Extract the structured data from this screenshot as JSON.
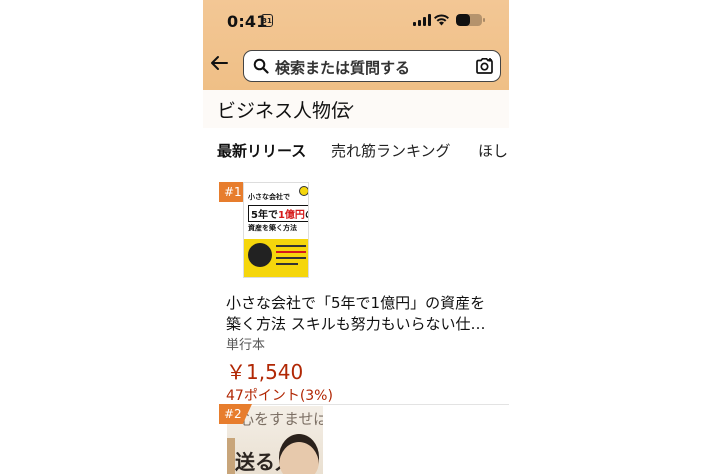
{
  "status_bar": {
    "time": "0:41",
    "calendar_badge": "31",
    "battery_level": 0.55
  },
  "search": {
    "placeholder": "検索または質問する"
  },
  "category": {
    "title": "ビジネス人物伝"
  },
  "tabs": [
    {
      "label": "最新リリース",
      "active": true
    },
    {
      "label": "売れ筋ランキング",
      "active": false
    },
    {
      "label": "ほし",
      "active": false
    }
  ],
  "items": [
    {
      "rank": "#1",
      "cover": {
        "line1": "小さな会社で",
        "big_pre": "5年で",
        "big_red": "1億円",
        "big_post": "の",
        "line3": "資産を築く方法"
      },
      "title_line1": "小さな会社で「5年で1億円」の資産を",
      "title_line2": "築く方法 スキルも努力もいらない仕…",
      "binding": "単行本",
      "price": "￥1,540",
      "points": "47ポイント(3%)"
    },
    {
      "rank": "#2",
      "cover": {
        "title": "心をすませば",
        "vertical": "送る人生"
      }
    }
  ],
  "colors": {
    "header_bg": "#f3c795",
    "rank_badge": "#e77d2d",
    "price": "#b12704"
  },
  "icons": {
    "back": "back-arrow-icon",
    "search": "search-icon",
    "camera": "camera-search-icon",
    "chevron": "chevron-down-icon"
  }
}
